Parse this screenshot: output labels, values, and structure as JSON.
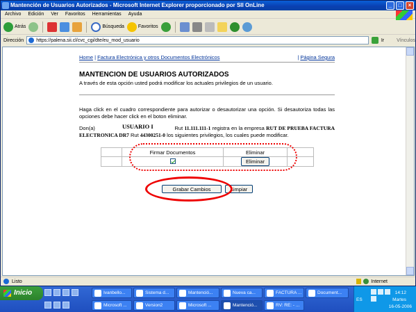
{
  "window": {
    "title": "Mantención de Usuarios Autorizados - Microsoft Internet Explorer proporcionado por SII OnLine",
    "buttons": [
      "_",
      "□",
      "×"
    ]
  },
  "menu": [
    "Archivo",
    "Edición",
    "Ver",
    "Favoritos",
    "Herramientas",
    "Ayuda"
  ],
  "toolbar": {
    "back": "Atrás",
    "search": "Búsqueda",
    "favorites": "Favoritos"
  },
  "address": {
    "label": "Dirección",
    "url": "https://palena.sii.cl/cvc_cgi/dte/eu_mod_usuario",
    "go": "Ir",
    "links": "Vínculos"
  },
  "page": {
    "nav": {
      "home": "Home",
      "separator": "|",
      "section": "Factura Electrónica y otros Documentos Electrónicos",
      "right_sep": "|",
      "secure": "Página Segura"
    },
    "title": "MANTENCION DE USUARIOS AUTORIZADOS",
    "subtitle": "A través de esta opción usted podrá modificar los actuales privilegios de un usuario.",
    "instructions": "Haga click en el cuadro correspondiente para autorizar o desautorizar una opción. Si desautoriza todas las opciones debe hacer click en el boton eliminar.",
    "user_label": "USUARIO I",
    "user_info": {
      "don": "Don(a)",
      "rut_label": "Rut",
      "rut": "11.111.111-1",
      "registers": "registra en la empresa",
      "company": "RUT DE PRUEBA FACTURA ELECTRONICA DR7",
      "rut2_label": "Rut",
      "rut2": "44300251-0",
      "tail": "los siguientes privilegios, los cuales puede modificar."
    },
    "table": {
      "headers": [
        "Firmar Documentos",
        "Eliminar"
      ],
      "firmar_checked": true,
      "eliminar_button": "Eliminar"
    },
    "buttons": {
      "grabar": "Grabar Cambios",
      "limpiar": "Limpiar"
    }
  },
  "status": {
    "text": "Listo",
    "zone": "Internet"
  },
  "taskbar": {
    "start": "Inicio",
    "row1": [
      "Ivanbello...",
      "Sistema d...",
      "Mantenció...",
      "Nueva ca...",
      "FACTURA ...",
      "Document..."
    ],
    "row2": [
      "Microsoft ...",
      "Version2",
      "Microsoft ...",
      "Mantenció...",
      "RV: RE: - ..."
    ],
    "tray": {
      "lang": "ES",
      "time": "14:12",
      "day": "Martes",
      "date": "16-05-2006"
    }
  }
}
